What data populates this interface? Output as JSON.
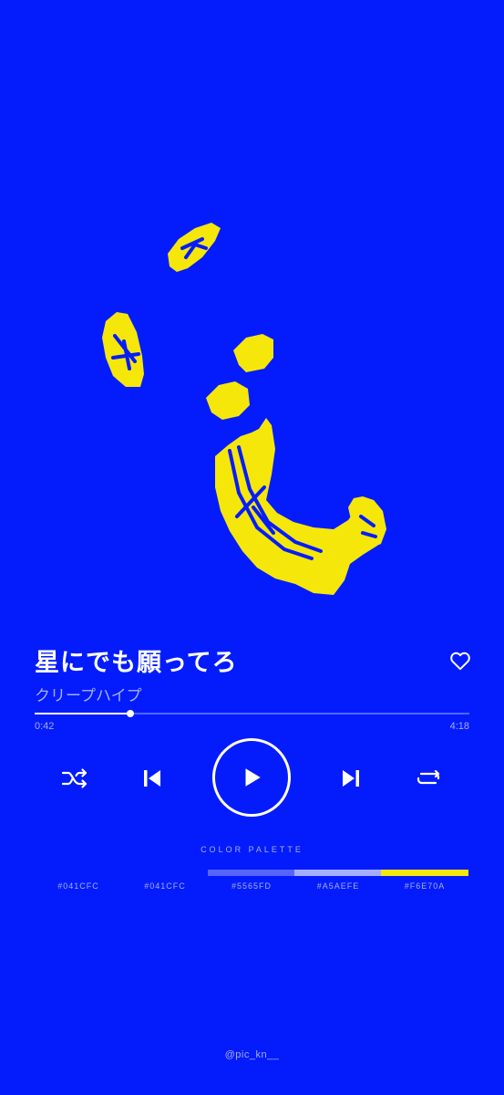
{
  "colors": {
    "background": "#041CFC",
    "accent": "#F6E70A",
    "muted": "#A5AEFE",
    "track": "#5565FD",
    "foreground": "#FFFFFF"
  },
  "track": {
    "title": "星にでも願ってろ",
    "artist": "クリープハイプ",
    "elapsed": "0:42",
    "duration": "4:18",
    "progress_fraction": 0.22
  },
  "controls": {
    "like_icon": "heart-outline-icon",
    "shuffle_icon": "shuffle-icon",
    "previous_icon": "skip-previous-icon",
    "play_icon": "play-icon",
    "next_icon": "skip-next-icon",
    "repeat_icon": "repeat-icon"
  },
  "palette": {
    "title": "COLOR PALETTE",
    "swatches": [
      {
        "label": "#041CFC",
        "color": "#041CFC"
      },
      {
        "label": "#041CFC",
        "color": "#041CFC"
      },
      {
        "label": "#5565FD",
        "color": "#5565FD"
      },
      {
        "label": "#A5AEFE",
        "color": "#A5AEFE"
      },
      {
        "label": "#F6E70A",
        "color": "#F6E70A"
      }
    ]
  },
  "credit": {
    "handle": "@pic_kn__"
  }
}
